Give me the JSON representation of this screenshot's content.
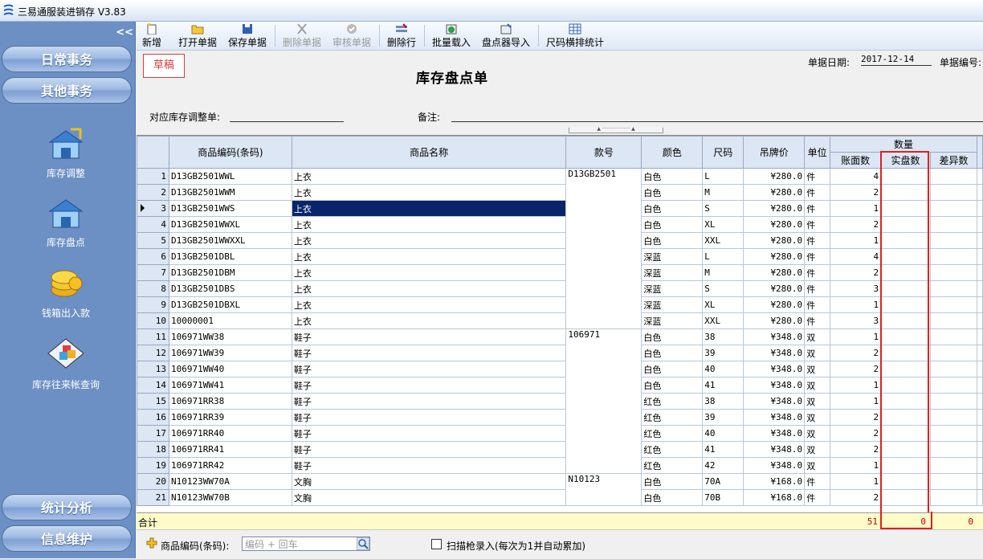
{
  "app": {
    "title": "三易通服装进销存 V3.83"
  },
  "sidebar": {
    "collapse": "<<",
    "top_buttons": [
      "日常事务",
      "其他事务"
    ],
    "tiles": [
      {
        "label": "库存调整",
        "icon": "warehouse-adjust-icon"
      },
      {
        "label": "库存盘点",
        "icon": "warehouse-count-icon"
      },
      {
        "label": "钱箱出入款",
        "icon": "cash-box-icon"
      },
      {
        "label": "库存往来帐查询",
        "icon": "ledger-query-icon"
      }
    ],
    "bottom_buttons": [
      "统计分析",
      "信息维护"
    ]
  },
  "toolbar": {
    "items": [
      {
        "label": "新增",
        "icon": "new-doc-icon",
        "enabled": true
      },
      {
        "label": "打开单据",
        "icon": "open-folder-icon",
        "enabled": true
      },
      {
        "label": "保存单据",
        "icon": "save-icon",
        "enabled": true
      },
      {
        "label": "删除单据",
        "icon": "delete-x-icon",
        "enabled": false
      },
      {
        "label": "审核单据",
        "icon": "audit-check-icon",
        "enabled": false
      },
      {
        "label": "删除行",
        "icon": "delete-row-icon",
        "enabled": true
      },
      {
        "label": "批量载入",
        "icon": "batch-load-icon",
        "enabled": true
      },
      {
        "label": "盘点器导入",
        "icon": "scanner-import-icon",
        "enabled": true
      },
      {
        "label": "尺码横排统计",
        "icon": "size-grid-icon",
        "enabled": true
      }
    ]
  },
  "form": {
    "status": "草稿",
    "title": "库存盘点单",
    "date_label": "单据日期:",
    "date_value": "2017-12-14",
    "number_label": "单据编号:",
    "adjust_label": "对应库存调整单:",
    "remark_label": "备注:",
    "splitter": "▲ ·················· ▲"
  },
  "grid": {
    "headers": {
      "code": "商品编码(条码)",
      "name": "商品名称",
      "style": "款号",
      "color": "颜色",
      "size": "尺码",
      "price": "吊牌价",
      "unit": "单位",
      "qty_group": "数量",
      "book": "账面数",
      "actual": "实盘数",
      "diff": "差异数"
    },
    "rows": [
      {
        "no": "1",
        "code": "D13GB2501WWL",
        "name": "上衣",
        "style": "D13GB2501",
        "color": "白色",
        "size": "L",
        "price": "¥280.0",
        "unit": "件",
        "book": "4"
      },
      {
        "no": "2",
        "code": "D13GB2501WWM",
        "name": "上衣",
        "style": "",
        "color": "白色",
        "size": "M",
        "price": "¥280.0",
        "unit": "件",
        "book": "2"
      },
      {
        "no": "3",
        "code": "D13GB2501WWS",
        "name": "上衣",
        "style": "",
        "color": "白色",
        "size": "S",
        "price": "¥280.0",
        "unit": "件",
        "book": "1"
      },
      {
        "no": "4",
        "code": "D13GB2501WWXL",
        "name": "上衣",
        "style": "",
        "color": "白色",
        "size": "XL",
        "price": "¥280.0",
        "unit": "件",
        "book": "2"
      },
      {
        "no": "5",
        "code": "D13GB2501WWXXL",
        "name": "上衣",
        "style": "",
        "color": "白色",
        "size": "XXL",
        "price": "¥280.0",
        "unit": "件",
        "book": "1"
      },
      {
        "no": "6",
        "code": "D13GB2501DBL",
        "name": "上衣",
        "style": "",
        "color": "深蓝",
        "size": "L",
        "price": "¥280.0",
        "unit": "件",
        "book": "4"
      },
      {
        "no": "7",
        "code": "D13GB2501DBM",
        "name": "上衣",
        "style": "",
        "color": "深蓝",
        "size": "M",
        "price": "¥280.0",
        "unit": "件",
        "book": "2"
      },
      {
        "no": "8",
        "code": "D13GB2501DBS",
        "name": "上衣",
        "style": "",
        "color": "深蓝",
        "size": "S",
        "price": "¥280.0",
        "unit": "件",
        "book": "3"
      },
      {
        "no": "9",
        "code": "D13GB2501DBXL",
        "name": "上衣",
        "style": "",
        "color": "深蓝",
        "size": "XL",
        "price": "¥280.0",
        "unit": "件",
        "book": "1"
      },
      {
        "no": "10",
        "code": "10000001",
        "name": "上衣",
        "style": "",
        "color": "深蓝",
        "size": "XXL",
        "price": "¥280.0",
        "unit": "件",
        "book": "3"
      },
      {
        "no": "11",
        "code": "106971WW38",
        "name": "鞋子",
        "style": "106971",
        "color": "白色",
        "size": "38",
        "price": "¥348.0",
        "unit": "双",
        "book": "1"
      },
      {
        "no": "12",
        "code": "106971WW39",
        "name": "鞋子",
        "style": "",
        "color": "白色",
        "size": "39",
        "price": "¥348.0",
        "unit": "双",
        "book": "2"
      },
      {
        "no": "13",
        "code": "106971WW40",
        "name": "鞋子",
        "style": "",
        "color": "白色",
        "size": "40",
        "price": "¥348.0",
        "unit": "双",
        "book": "2"
      },
      {
        "no": "14",
        "code": "106971WW41",
        "name": "鞋子",
        "style": "",
        "color": "白色",
        "size": "41",
        "price": "¥348.0",
        "unit": "双",
        "book": "1"
      },
      {
        "no": "15",
        "code": "106971RR38",
        "name": "鞋子",
        "style": "",
        "color": "红色",
        "size": "38",
        "price": "¥348.0",
        "unit": "双",
        "book": "1"
      },
      {
        "no": "16",
        "code": "106971RR39",
        "name": "鞋子",
        "style": "",
        "color": "红色",
        "size": "39",
        "price": "¥348.0",
        "unit": "双",
        "book": "2"
      },
      {
        "no": "17",
        "code": "106971RR40",
        "name": "鞋子",
        "style": "",
        "color": "红色",
        "size": "40",
        "price": "¥348.0",
        "unit": "双",
        "book": "2"
      },
      {
        "no": "18",
        "code": "106971RR41",
        "name": "鞋子",
        "style": "",
        "color": "红色",
        "size": "41",
        "price": "¥348.0",
        "unit": "双",
        "book": "2"
      },
      {
        "no": "19",
        "code": "106971RR42",
        "name": "鞋子",
        "style": "",
        "color": "红色",
        "size": "42",
        "price": "¥348.0",
        "unit": "双",
        "book": "1"
      },
      {
        "no": "20",
        "code": "N10123WW70A",
        "name": "文胸",
        "style": "N10123",
        "color": "白色",
        "size": "70A",
        "price": "¥168.0",
        "unit": "件",
        "book": "1"
      },
      {
        "no": "21",
        "code": "N10123WW70B",
        "name": "文胸",
        "style": "",
        "color": "白色",
        "size": "70B",
        "price": "¥168.0",
        "unit": "件",
        "book": "2"
      }
    ],
    "selected_row": 3,
    "total": {
      "label": "合计",
      "book": "51",
      "actual": "0",
      "diff": "0"
    }
  },
  "bottom": {
    "code_label": "商品编码(条码):",
    "code_placeholder": "编码 + 回车",
    "scan_label": "扫描枪录入(每次为1并自动累加)"
  }
}
